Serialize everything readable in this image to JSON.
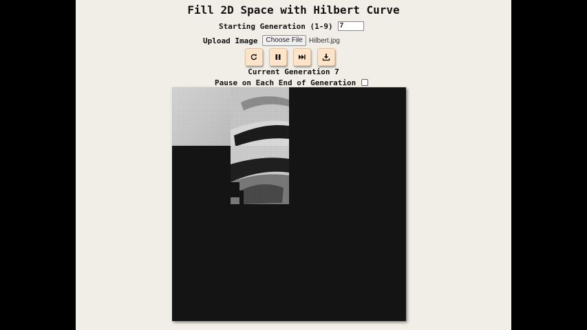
{
  "page": {
    "title": "Fill 2D Space with Hilbert Curve"
  },
  "controls": {
    "starting_generation_label": "Starting Generation (1-9)",
    "starting_generation_value": "7",
    "upload_label": "Upload Image",
    "choose_file_label": "Choose File",
    "file_name": "Hilbert.jpg",
    "buttons": [
      {
        "name": "restart-button",
        "icon": "restart-icon"
      },
      {
        "name": "pause-button",
        "icon": "pause-icon"
      },
      {
        "name": "next-generation-button",
        "icon": "skip-forward-icon"
      },
      {
        "name": "download-button",
        "icon": "download-icon"
      }
    ]
  },
  "status": {
    "current_generation_label": "Current Generation 7",
    "pause_label": "Pause on Each End of Generation",
    "pause_checked": false
  },
  "colors": {
    "page_background": "#f0eee6",
    "outer_background": "#000000",
    "button_background": "#fde3c7",
    "canvas_background": "#141414"
  }
}
